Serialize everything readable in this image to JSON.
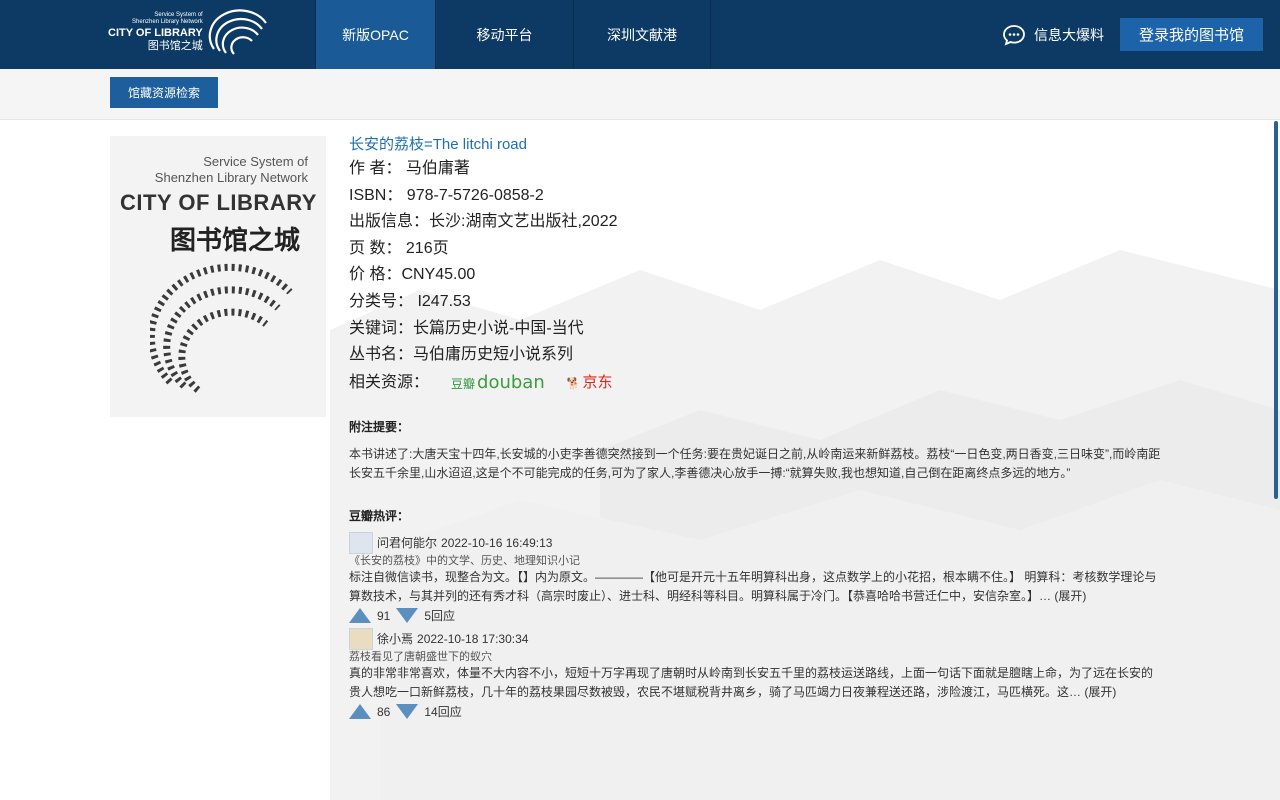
{
  "header": {
    "logo_line1": "Service System of",
    "logo_line2": "Shenzhen Library Network",
    "logo_line3": "CITY OF LIBRARY",
    "logo_line4": "图书馆之城",
    "nav": [
      "新版OPAC",
      "移动平台",
      "深圳文献港"
    ],
    "feedback_label": "信息大爆料",
    "login_label": "登录我的图书馆"
  },
  "subbar": {
    "search_tab": "馆藏资源检索"
  },
  "cover": {
    "line1": "Service System of",
    "line2": "Shenzhen Library Network",
    "line3": "CITY OF LIBRARY",
    "line4": "图书馆之城"
  },
  "book": {
    "title": "长安的荔枝=The litchi road",
    "author": "作 者： 马伯庸著",
    "isbn": "ISBN： 978-7-5726-0858-2",
    "publisher": "出版信息：长沙:湖南文艺出版社,2022",
    "pages": "页 数： 216页",
    "price": "价 格：CNY45.00",
    "class_no": "分类号： I247.53",
    "keywords": "关键词：长篇历史小说-中国-当代",
    "series": "丛书名：马伯庸历史短小说系列",
    "resources_label": "相关资源：",
    "douban_cn": "豆瓣",
    "douban_en": "douban",
    "jd_label": "京东"
  },
  "summary": {
    "heading": "附注提要：",
    "text": "本书讲述了:大唐天宝十四年,长安城的小吏李善德突然接到一个任务:要在贵妃诞日之前,从岭南运来新鲜荔枝。荔枝“一日色变,两日香变,三日味变”,而岭南距长安五千余里,山水迢迢,这是个不可能完成的任务,可为了家人,李善德决心放手一搏:“就算失败,我也想知道,自己倒在距离终点多远的地方。”"
  },
  "reviews": {
    "heading": "豆瓣热评：",
    "items": [
      {
        "user": "问君何能尔",
        "time": "2022-10-16 16:49:13",
        "title": "《长安的荔枝》中的文学、历史、地理知识小记",
        "body": "标注自微信读书，现整合为文。【】内为原文。————【他可是开元十五年明算科出身，这点数学上的小花招，根本瞒不住。】 明算科：考核数学理论与算数技术，与其并列的还有秀才科（高宗时废止）、进士科、明经科等科目。明算科属于冷门。【恭喜哈哈书营迁仁中，安信杂室。】… (展开)",
        "up": "91",
        "replies": "5回应"
      },
      {
        "user": "徐小焉",
        "time": "2022-10-18 17:30:34",
        "title": "荔枝看见了唐朝盛世下的蚁穴",
        "body": "真的非常非常喜欢，体量不大内容不小，短短十万字再现了唐朝时从岭南到长安五千里的荔枝运送路线，上面一句话下面就是膻瞎上命，为了远在长安的贵人想吃一口新鲜荔枝，几十年的荔枝果园尽数被毁，农民不堪赋税背井离乡，骑了马匹竭力日夜兼程送还路，涉险渡江，马匹横死。这… (展开)",
        "up": "86",
        "replies": "14回应"
      }
    ]
  },
  "colors": {
    "nav_bg": "#0c3a64",
    "nav_active": "#1a5b97",
    "link": "#1d6fb5",
    "login_btn": "#1d63aa"
  }
}
